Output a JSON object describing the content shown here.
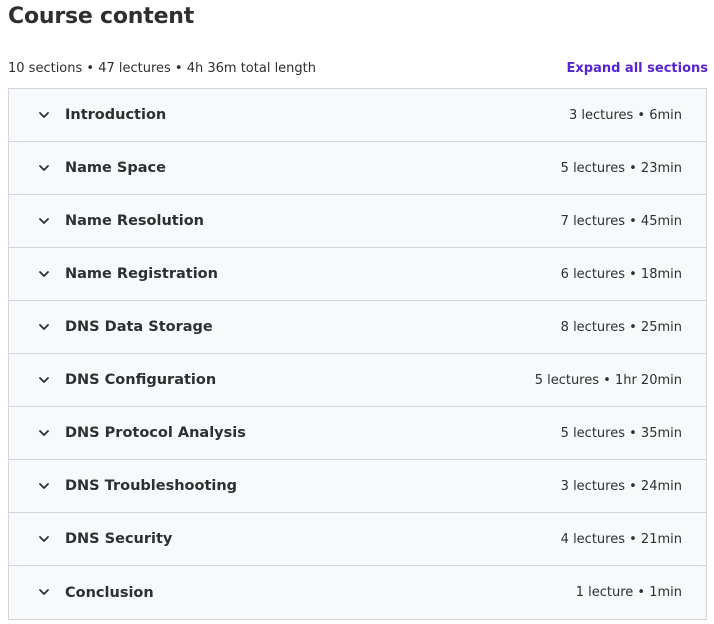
{
  "header": {
    "title": "Course content"
  },
  "summary": {
    "text": "10 sections • 47 lectures • 4h 36m total length",
    "expand_label": "Expand all sections"
  },
  "sections": [
    {
      "title": "Introduction",
      "meta": "3 lectures • 6min"
    },
    {
      "title": "Name Space",
      "meta": "5 lectures • 23min"
    },
    {
      "title": "Name Resolution",
      "meta": "7 lectures • 45min"
    },
    {
      "title": "Name Registration",
      "meta": "6 lectures • 18min"
    },
    {
      "title": "DNS Data Storage",
      "meta": "8 lectures • 25min"
    },
    {
      "title": "DNS Configuration",
      "meta": "5 lectures • 1hr 20min"
    },
    {
      "title": "DNS Protocol Analysis",
      "meta": "5 lectures • 35min"
    },
    {
      "title": "DNS Troubleshooting",
      "meta": "3 lectures • 24min"
    },
    {
      "title": "DNS Security",
      "meta": "4 lectures • 21min"
    },
    {
      "title": "Conclusion",
      "meta": "1 lecture • 1min"
    }
  ],
  "icons": {
    "section_toggle": "chevron-down-icon"
  },
  "colors": {
    "text": "#2d2f31",
    "link": "#5624d0",
    "row_background": "#f7f9fa",
    "border": "#d1d7dc"
  }
}
